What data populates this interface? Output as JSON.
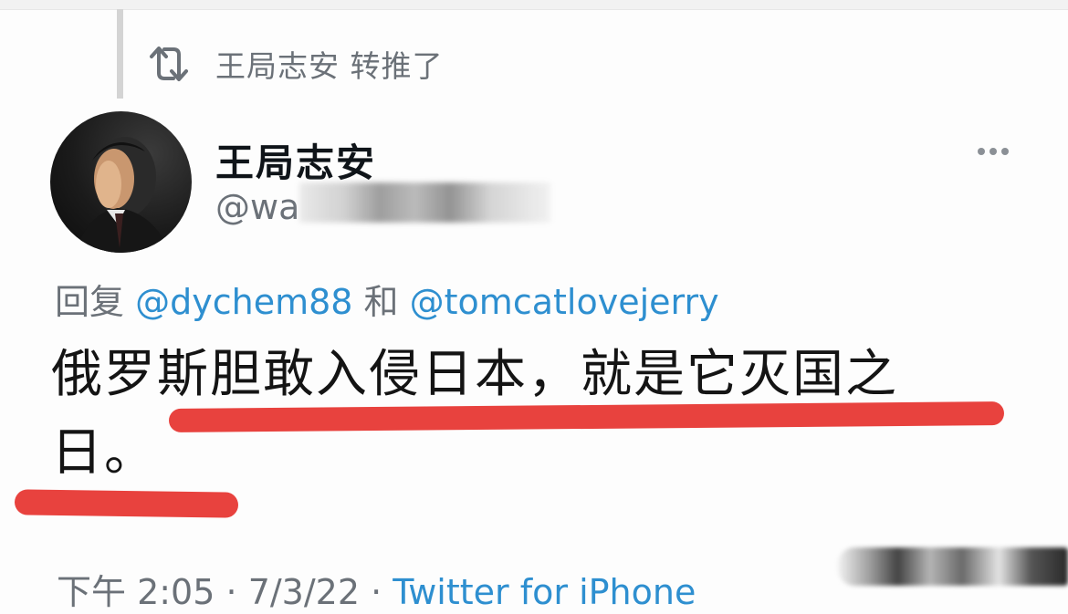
{
  "retweet": {
    "icon": "retweet-icon",
    "text": "王局志安 转推了"
  },
  "author": {
    "display_name": "王局志安",
    "handle_visible": "@wa",
    "avatar": "avatar-photo"
  },
  "menu": {
    "icon": "more-horizontal-icon"
  },
  "reply": {
    "prefix": "回复",
    "mention_1": "@dychem88",
    "joiner": "和",
    "mention_2": "@tomcatlovejerry"
  },
  "tweet": {
    "line_1": "俄罗斯胆敢入侵日本，就是它灭国之",
    "line_2": "日。"
  },
  "meta": {
    "time": "下午 2:05",
    "separator": "·",
    "date": "7/3/22",
    "source": "Twitter for iPhone"
  },
  "colors": {
    "link": "#2e8fd0",
    "muted": "#6b7178",
    "text": "#141414",
    "annotation": "#e8423e"
  }
}
